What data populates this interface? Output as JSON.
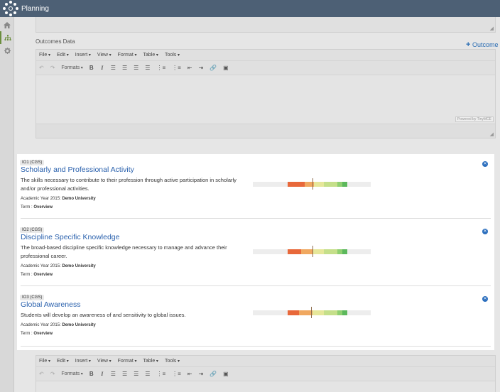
{
  "app": {
    "title": "Planning"
  },
  "sidebar": {
    "icons": [
      "home-icon",
      "hierarchy-icon",
      "gear-icon"
    ]
  },
  "outcomes_data": {
    "label": "Outcomes Data",
    "add_label": "Outcome",
    "powered_by": "Powered by TinyMCE"
  },
  "editor": {
    "menus": [
      "File",
      "Edit",
      "Insert",
      "View",
      "Format",
      "Table",
      "Tools"
    ],
    "formats_label": "Formats",
    "bold_label": "B",
    "italic_label": "I"
  },
  "outcomes": [
    {
      "badge": "IO1 (CGS)",
      "title": "Scholarly and Professional Activity",
      "description": "The skills necessary to contribute to their profession through active participation in scholarly and/or professional activities.",
      "year_label": "Academic Year 2015:",
      "year_value": "Demo University",
      "term_label": "Term :",
      "term_value": "Overview"
    },
    {
      "badge": "IO2 (CGS)",
      "title": "Discipline Specific Knowledge",
      "description": "The broad-based discipline specific knowledge necessary to manage and advance their professional career.",
      "year_label": "Academic Year 2015:",
      "year_value": "Demo University",
      "term_label": "Term :",
      "term_value": "Overview"
    },
    {
      "badge": "IO3 (CGS)",
      "title": "Global Awareness",
      "description": "Students will develop an awareness of and sensitivity to global issues.",
      "year_label": "Academic Year 2015:",
      "year_value": "Demo University",
      "term_label": "Term :",
      "term_value": "Overview"
    }
  ],
  "colors": {
    "topbar": "#4d6075",
    "link": "#2a61ad",
    "scale_red": "#e8683a",
    "scale_orange": "#f0a860",
    "scale_yellow": "#cfe08a",
    "scale_lightgreen": "#a8d87a",
    "scale_green": "#5cb85c"
  }
}
